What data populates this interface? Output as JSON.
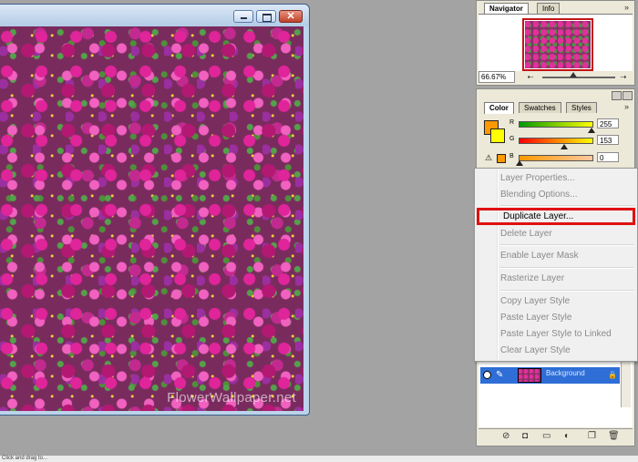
{
  "document": {
    "watermark": "FlowerWallpaper.net",
    "window_buttons": {
      "minimize": "",
      "maximize": "",
      "close": "✕"
    }
  },
  "navigator": {
    "tabs": [
      "Navigator",
      "Info"
    ],
    "zoom": "66.67%"
  },
  "color": {
    "tabs": [
      "Color",
      "Swatches",
      "Styles"
    ],
    "foreground": "#ff9900",
    "background": "#ffff00",
    "channels": [
      {
        "label": "R",
        "value": "255"
      },
      {
        "label": "G",
        "value": "153"
      },
      {
        "label": "B",
        "value": "0"
      }
    ]
  },
  "context_menu": {
    "items": [
      {
        "label": "Layer Properties...",
        "enabled": false
      },
      {
        "label": "Blending Options...",
        "enabled": false
      },
      {
        "label": "Duplicate Layer...",
        "enabled": true,
        "highlighted": true
      },
      {
        "label": "Delete Layer",
        "enabled": false
      },
      {
        "label": "Enable Layer Mask",
        "enabled": false
      },
      {
        "label": "Rasterize Layer",
        "enabled": false
      },
      {
        "label": "Copy Layer Style",
        "enabled": false
      },
      {
        "label": "Paste Layer Style",
        "enabled": false
      },
      {
        "label": "Paste Layer Style to Linked",
        "enabled": false
      },
      {
        "label": "Clear Layer Style",
        "enabled": false
      }
    ]
  },
  "layers": {
    "rows": [
      {
        "name": "Background"
      }
    ]
  },
  "status_bar": {
    "text": "Click and drag to..."
  },
  "colors": {
    "highlight_box": "#e01010",
    "selected_layer": "#2e6ed6"
  }
}
